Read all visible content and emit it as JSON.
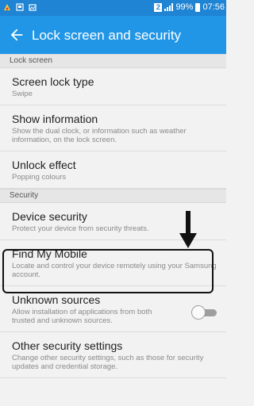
{
  "status_bar": {
    "sim_label": "2",
    "battery": "99%",
    "time": "07:56"
  },
  "app_bar": {
    "back_icon": "arrow-back-icon",
    "title": "Lock screen and security"
  },
  "sections": [
    {
      "header": "Lock screen",
      "items": [
        {
          "title": "Screen lock type",
          "subtitle": "Swipe"
        },
        {
          "title": "Show information",
          "subtitle": "Show the dual clock, or information such as weather information, on the lock screen."
        },
        {
          "title": "Unlock effect",
          "subtitle": "Popping colours"
        }
      ]
    },
    {
      "header": "Security",
      "items": [
        {
          "title": "Device security",
          "subtitle": "Protect your device from security threats."
        },
        {
          "title": "Find My Mobile",
          "subtitle": "Locate and control your device remotely using your Samsung account."
        },
        {
          "title": "Unknown sources",
          "subtitle": "Allow installation of applications from both trusted and unknown sources.",
          "toggle": "off"
        },
        {
          "title": "Other security settings",
          "subtitle": "Change other security settings, such as those for security updates and credential storage."
        }
      ]
    }
  ],
  "annotation": {
    "arrow_icon": "down-arrow-icon",
    "highlight_color": "#111111"
  },
  "colors": {
    "status_bar": "#1e84d3",
    "app_bar": "#2196e6",
    "background": "#f2f2f2"
  }
}
